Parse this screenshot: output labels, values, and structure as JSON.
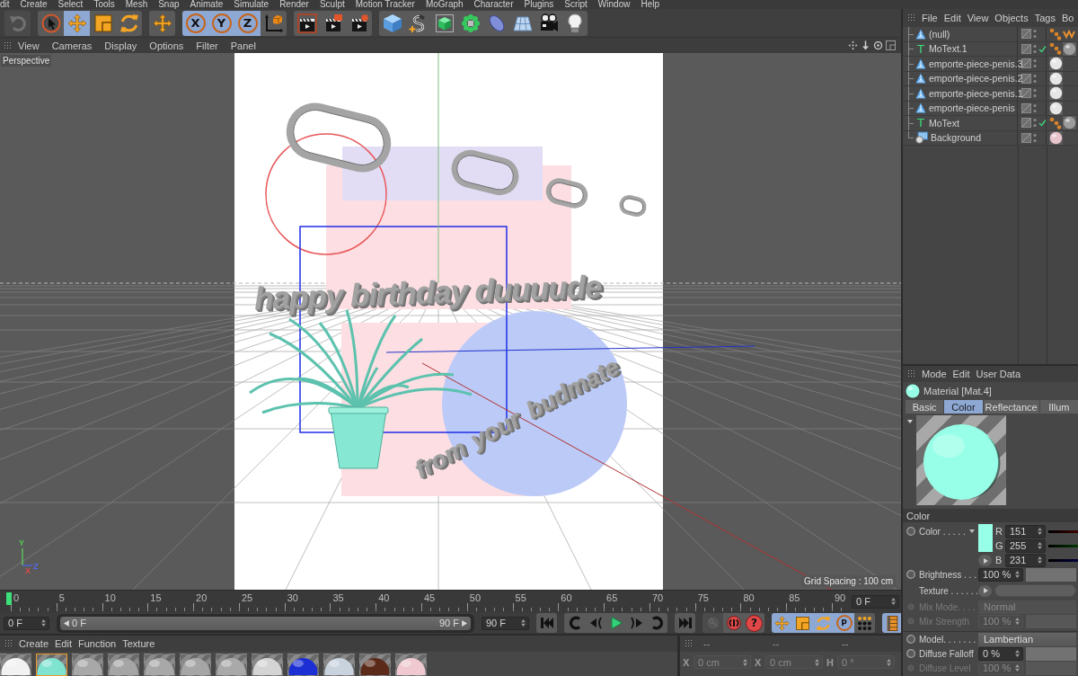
{
  "menu_bar": [
    "dit",
    "Create",
    "Select",
    "Tools",
    "Mesh",
    "Snap",
    "Animate",
    "Simulate",
    "Render",
    "Sculpt",
    "Motion Tracker",
    "MoGraph",
    "Character",
    "Plugins",
    "Script",
    "Window",
    "Help"
  ],
  "toolbar": {
    "groups": [
      {
        "tools": [
          {
            "kind": "undo",
            "selected": false,
            "disabled": true
          }
        ]
      },
      {
        "tools": [
          {
            "kind": "select",
            "selected": false,
            "disabled": false
          },
          {
            "kind": "move",
            "selected": true,
            "disabled": false
          },
          {
            "kind": "scale",
            "selected": false,
            "disabled": false
          },
          {
            "kind": "rotate",
            "selected": false,
            "disabled": false
          }
        ]
      },
      {
        "tools": [
          {
            "kind": "move",
            "selected": false,
            "disabled": false
          }
        ]
      },
      {
        "tools": [
          {
            "kind": "axis",
            "label": "X",
            "selected": true,
            "disabled": false
          },
          {
            "kind": "axis",
            "label": "Y",
            "selected": true,
            "disabled": false
          },
          {
            "kind": "axis",
            "label": "Z",
            "selected": true,
            "disabled": false
          },
          {
            "kind": "coordinates",
            "selected": false,
            "disabled": false
          }
        ]
      },
      {
        "tools": [
          {
            "kind": "render-view",
            "selected": false,
            "disabled": false
          },
          {
            "kind": "render-picture",
            "selected": false,
            "disabled": false
          },
          {
            "kind": "render-settings",
            "selected": false,
            "disabled": false
          }
        ]
      },
      {
        "tools": [
          {
            "kind": "cube",
            "selected": false,
            "disabled": false
          },
          {
            "kind": "spline",
            "selected": false,
            "disabled": false
          },
          {
            "kind": "subdivision",
            "selected": false,
            "disabled": false
          },
          {
            "kind": "cloner",
            "selected": false,
            "disabled": false
          },
          {
            "kind": "deformer",
            "selected": false,
            "disabled": false
          },
          {
            "kind": "floor",
            "selected": false,
            "disabled": false
          },
          {
            "kind": "camera",
            "selected": false,
            "disabled": false
          },
          {
            "kind": "light",
            "selected": false,
            "disabled": false
          }
        ]
      }
    ]
  },
  "viewport": {
    "menu": [
      "View",
      "Cameras",
      "Display",
      "Options",
      "Filter",
      "Panel"
    ],
    "camera": "Perspective",
    "scene_texts": [
      {
        "kind": "headline",
        "text": "happy birthday duuuude"
      },
      {
        "kind": "signature",
        "words": [
          "from",
          "your",
          "budmate"
        ]
      }
    ],
    "gizmo_axes": [
      "Y",
      "X",
      "Z"
    ],
    "grid_info": "Grid Spacing : 100 cm"
  },
  "timeline": {
    "ticks": [
      "0",
      "5",
      "10",
      "15",
      "20",
      "25",
      "30",
      "35",
      "40",
      "45",
      "50",
      "55",
      "60",
      "65",
      "70",
      "75",
      "80",
      "85",
      "90"
    ],
    "playhead": {
      "level": 0
    },
    "current_frame": "0 F",
    "start_frame": "0 F",
    "range": {
      "start": "0 F",
      "end": "90 F",
      "level": 1
    },
    "end_frame": "90 F",
    "transport": [
      {
        "buttons": [
          {
            "kind": "first"
          }
        ]
      },
      {
        "buttons": [
          {
            "kind": "prev-key"
          },
          {
            "kind": "prev-frame"
          },
          {
            "kind": "play"
          },
          {
            "kind": "next-frame"
          },
          {
            "kind": "next-key"
          }
        ]
      },
      {
        "buttons": [
          {
            "kind": "last"
          }
        ]
      }
    ],
    "keying": [
      {
        "kind": "key",
        "disabled": true
      },
      {
        "kind": "record",
        "disabled": false
      },
      {
        "kind": "auto",
        "label": "?",
        "disabled": false
      }
    ],
    "channels": [
      {
        "kind": "move",
        "selected": true
      },
      {
        "kind": "scale",
        "selected": true
      },
      {
        "kind": "rotate",
        "selected": true
      },
      {
        "kind": "param",
        "label": "P",
        "selected": true
      },
      {
        "kind": "points",
        "selected": false
      }
    ],
    "timeline_view": {
      "selected": true
    }
  },
  "material_manager": {
    "menu": [
      "Create",
      "Edit",
      "Function",
      "Texture"
    ],
    "materials": [
      {
        "color": "#f2f2f2",
        "selected": false
      },
      {
        "color": "#7fe3cf",
        "selected": true
      },
      {
        "color": "#a8a8a8",
        "selected": false
      },
      {
        "color": "#a5a5a5",
        "selected": false
      },
      {
        "color": "#a8a8a8",
        "selected": false
      },
      {
        "color": "#a6a6a6",
        "selected": false
      },
      {
        "color": "#a9a9a9",
        "selected": false
      },
      {
        "color": "#d4d4d4",
        "selected": false
      },
      {
        "color": "#1b2fd4",
        "selected": false
      },
      {
        "color": "#c9d3de",
        "selected": false
      },
      {
        "color": "#5b2a19",
        "selected": false
      },
      {
        "color": "#efc8d0",
        "selected": false
      }
    ]
  },
  "coordinates": {
    "headers": [
      "--",
      "--",
      "--"
    ],
    "fields": [
      {
        "axis": "X",
        "value": "0 cm",
        "disabled": true
      },
      {
        "axis": "X",
        "value": "0 cm",
        "disabled": true
      },
      {
        "axis": "H",
        "value": "0 °",
        "disabled": true
      }
    ]
  },
  "object_manager": {
    "menu": [
      "File",
      "Edit",
      "View",
      "Objects",
      "Tags",
      "Bo"
    ],
    "objects": [
      {
        "name": "(null)",
        "kind": "null",
        "checked": false,
        "tags": [
          {
            "kind": "dots"
          },
          {
            "kind": "zigzag"
          }
        ]
      },
      {
        "name": "MoText.1",
        "kind": "text",
        "glyph": "T",
        "checked": true,
        "tags": [
          {
            "kind": "dots"
          },
          {
            "kind": "material",
            "color": "#9c9c9c"
          }
        ]
      },
      {
        "name": "emporte-piece-penis.3",
        "kind": "null",
        "checked": false,
        "tags": [
          {
            "kind": "material",
            "color": "#e6e6e6"
          }
        ]
      },
      {
        "name": "emporte-piece-penis.2",
        "kind": "null",
        "checked": false,
        "tags": [
          {
            "kind": "material",
            "color": "#e6e6e6"
          }
        ]
      },
      {
        "name": "emporte-piece-penis.1",
        "kind": "null",
        "checked": false,
        "tags": [
          {
            "kind": "material",
            "color": "#e6e6e6"
          }
        ]
      },
      {
        "name": "emporte-piece-penis",
        "kind": "null",
        "checked": false,
        "tags": [
          {
            "kind": "material",
            "color": "#e6e6e6"
          }
        ]
      },
      {
        "name": "MoText",
        "kind": "text",
        "glyph": "T",
        "checked": true,
        "tags": [
          {
            "kind": "dots"
          },
          {
            "kind": "material",
            "color": "#9c9c9c"
          }
        ]
      },
      {
        "name": "Background",
        "kind": "background",
        "checked": false,
        "tags": [
          {
            "kind": "material",
            "color": "#e8c4cc"
          }
        ]
      }
    ]
  },
  "attribute_manager": {
    "menu": [
      "Mode",
      "Edit",
      "User Data"
    ],
    "title": "Material [Mat.4]",
    "tabs": [
      {
        "label": "Basic",
        "selected": false
      },
      {
        "label": "Color",
        "selected": true
      },
      {
        "label": "Reflectance",
        "selected": false
      },
      {
        "label": "Illum",
        "selected": false
      }
    ],
    "section": "Color",
    "color": {
      "label": "Color . . . . .",
      "channels": [
        {
          "name": "R",
          "value": "151"
        },
        {
          "name": "G",
          "value": "255"
        },
        {
          "name": "B",
          "value": "231"
        }
      ]
    },
    "groups": [
      {
        "rows": [
          {
            "kind": "number",
            "label": "Brightness . . .",
            "value": "100 %",
            "disabled": false
          },
          {
            "kind": "texture",
            "label": "Texture . . . . . .",
            "disabled": false
          },
          {
            "kind": "dropdown",
            "label": "Mix Mode. . . .",
            "value": "Normal",
            "disabled": true
          },
          {
            "kind": "number",
            "label": "Mix Strength",
            "value": "100 %",
            "disabled": true
          }
        ]
      },
      {
        "rows": [
          {
            "kind": "dropdown",
            "label": "Model. . . . . . .",
            "value": "Lambertian",
            "disabled": false
          },
          {
            "kind": "number",
            "label": "Diffuse Falloff",
            "value": "0 %",
            "disabled": false
          },
          {
            "kind": "number",
            "label": "Diffuse Level",
            "value": "100 %",
            "disabled": true
          }
        ]
      }
    ]
  }
}
